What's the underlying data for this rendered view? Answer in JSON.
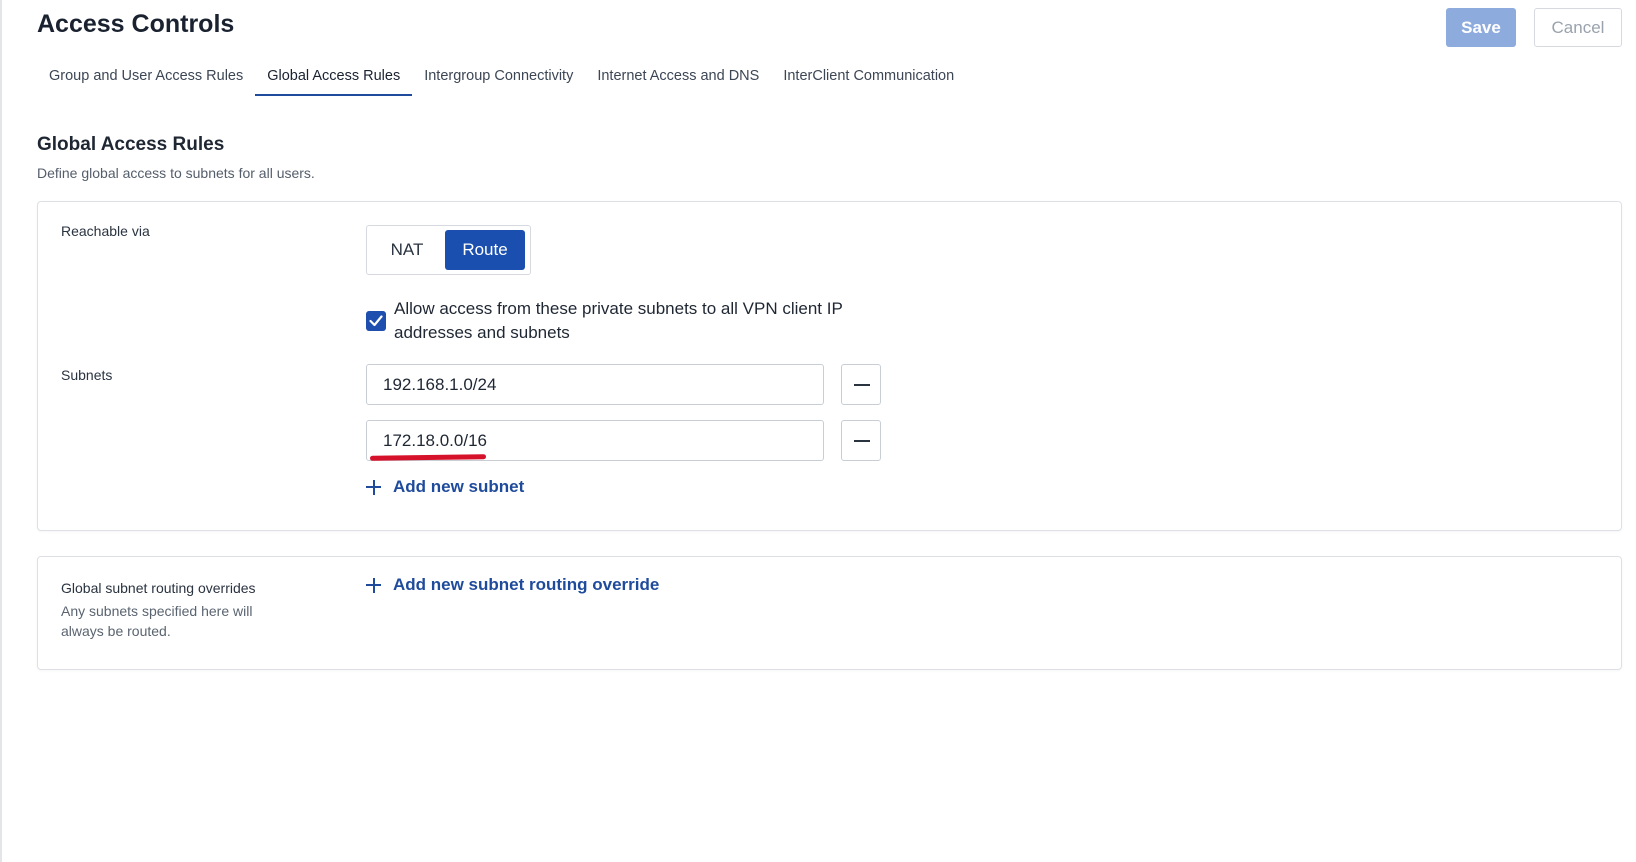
{
  "header": {
    "title": "Access Controls",
    "save_label": "Save",
    "cancel_label": "Cancel"
  },
  "tabs": [
    {
      "label": "Group and User Access Rules",
      "active": false
    },
    {
      "label": "Global Access Rules",
      "active": true
    },
    {
      "label": "Intergroup Connectivity",
      "active": false
    },
    {
      "label": "Internet Access and DNS",
      "active": false
    },
    {
      "label": "InterClient Communication",
      "active": false
    }
  ],
  "section": {
    "title": "Global Access Rules",
    "description": "Define global access to subnets for all users."
  },
  "reachable": {
    "label": "Reachable via",
    "options": [
      "NAT",
      "Route"
    ],
    "selected": "Route"
  },
  "allow_access": {
    "checked": true,
    "label": "Allow access from these private subnets to all VPN client IP addresses and subnets"
  },
  "subnets": {
    "label": "Subnets",
    "values": [
      "192.168.1.0/24",
      "172.18.0.0/16"
    ],
    "add_label": "Add new subnet"
  },
  "overrides": {
    "label": "Global subnet routing overrides",
    "description": "Any subnets specified here will always be routed.",
    "add_label": "Add new subnet routing override"
  },
  "colors": {
    "accent": "#1a4fb0",
    "save_disabled": "#8eabde",
    "annotation_underline": "#d5122a"
  }
}
